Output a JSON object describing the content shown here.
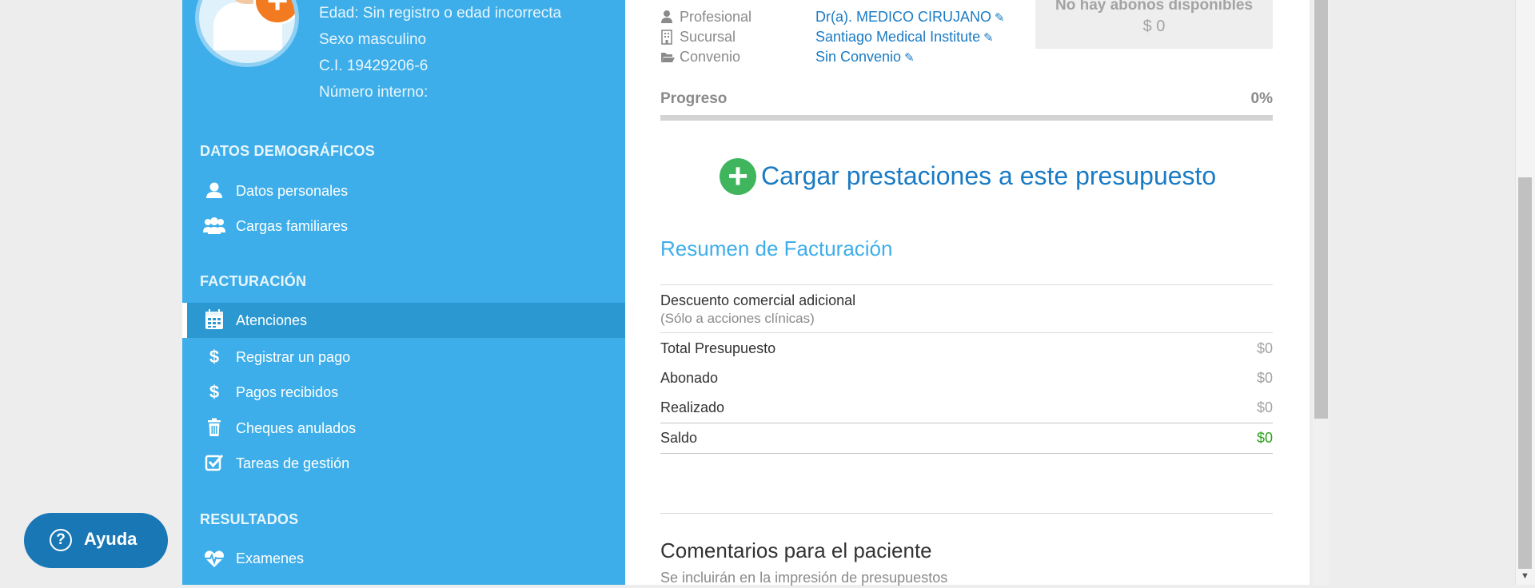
{
  "patient": {
    "edad": "Edad: Sin registro o edad incorrecta",
    "sexo": "Sexo masculino",
    "ci": "C.I. 19429206-6",
    "numero_interno": "Número interno:"
  },
  "sidebar": {
    "sections": [
      {
        "title": "DATOS DEMOGRÁFICOS",
        "items": [
          {
            "label": "Datos personales",
            "icon": "user-icon"
          },
          {
            "label": "Cargas familiares",
            "icon": "users-icon"
          }
        ]
      },
      {
        "title": "FACTURACIÓN",
        "items": [
          {
            "label": "Atenciones",
            "icon": "calendar-icon",
            "active": true
          },
          {
            "label": "Registrar un pago",
            "icon": "dollar-icon"
          },
          {
            "label": "Pagos recibidos",
            "icon": "dollar-icon"
          },
          {
            "label": "Cheques anulados",
            "icon": "trash-icon"
          },
          {
            "label": "Tareas de gestión",
            "icon": "checkbox-icon"
          }
        ]
      },
      {
        "title": "RESULTADOS",
        "items": [
          {
            "label": "Examenes",
            "icon": "heartbeat-icon"
          }
        ]
      }
    ]
  },
  "info": {
    "profesional": {
      "key": "Profesional",
      "value": "Dr(a). MEDICO CIRUJANO",
      "icon": "user-md-icon"
    },
    "sucursal": {
      "key": "Sucursal",
      "value": "Santiago Medical Institute",
      "icon": "building-icon"
    },
    "convenio": {
      "key": "Convenio",
      "value": "Sin Convenio",
      "icon": "folder-open-icon"
    }
  },
  "abonos": {
    "title": "No hay abonos disponibles",
    "amount": "$ 0"
  },
  "progress": {
    "label": "Progreso",
    "percent_text": "0%",
    "value": 0
  },
  "cargar_label": "Cargar prestaciones a este presupuesto",
  "resumen": {
    "title": "Resumen de Facturación",
    "descuento_label": "Descuento comercial adicional",
    "descuento_sub": "(Sólo a acciones clínicas)",
    "rows": [
      {
        "label": "Total Presupuesto",
        "value": "$0"
      },
      {
        "label": "Abonado",
        "value": "$0"
      },
      {
        "label": "Realizado",
        "value": "$0"
      },
      {
        "label": "Saldo",
        "value": "$0"
      }
    ]
  },
  "comentarios": {
    "title": "Comentarios para el paciente",
    "subtitle": "Se incluirán en la impresión de presupuestos"
  },
  "help": {
    "label": "Ayuda"
  },
  "colors": {
    "sidebar_bg": "#3daee9",
    "sidebar_active": "#2b98d1",
    "link": "#1a7bc4",
    "add_green": "#3fb55e",
    "saldo_green": "#2aa01a",
    "help_bg": "#1977b5"
  }
}
